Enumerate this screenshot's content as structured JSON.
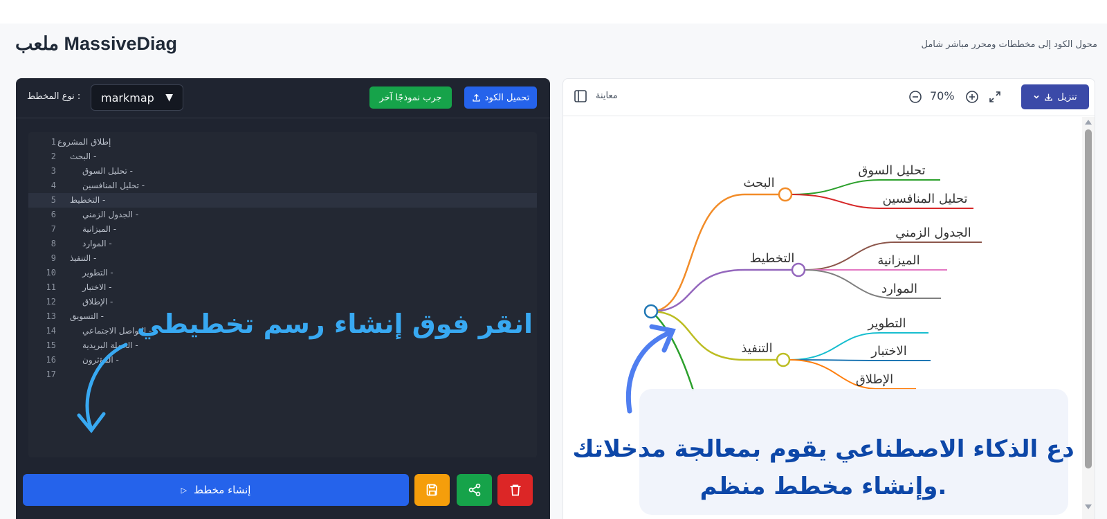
{
  "header": {
    "title": "MassiveDiag ملعب",
    "subtitle": "محول الكود إلى مخططات ومحرر مباشر شامل"
  },
  "editor": {
    "diagram_type_label": ": نوع المخطط",
    "diagram_type_value": "markmap",
    "try_sample_label": "جرب نموذجًا آخر",
    "load_code_label": "تحميل الكود",
    "code_lines": [
      {
        "n": "1",
        "text": "إطلاق المشروع"
      },
      {
        "n": "2",
        "text": "- البحث"
      },
      {
        "n": "3",
        "text": "- تحليل السوق"
      },
      {
        "n": "4",
        "text": "- تحليل المنافسين"
      },
      {
        "n": "5",
        "text": "- التخطيط"
      },
      {
        "n": "6",
        "text": "- الجدول الزمني"
      },
      {
        "n": "7",
        "text": "- الميزانية"
      },
      {
        "n": "8",
        "text": "- الموارد"
      },
      {
        "n": "9",
        "text": "- التنفيذ"
      },
      {
        "n": "10",
        "text": "- التطوير"
      },
      {
        "n": "11",
        "text": "- الاختبار"
      },
      {
        "n": "12",
        "text": "- الإطلاق"
      },
      {
        "n": "13",
        "text": "- التسويق"
      },
      {
        "n": "14",
        "text": "- التواصل الاجتماعي"
      },
      {
        "n": "15",
        "text": "- الحملة البريدية"
      },
      {
        "n": "16",
        "text": "- المؤثرون"
      },
      {
        "n": "17",
        "text": ""
      }
    ],
    "generate_label": "إنشاء مخطط"
  },
  "preview": {
    "label": "معاينة",
    "zoom": "70%",
    "download_label": "تنزيل",
    "mindmap": {
      "branches": [
        {
          "label": "البحث",
          "color": "#f28c28",
          "children": [
            {
              "label": "تحليل السوق",
              "color": "#2ca02c"
            },
            {
              "label": "تحليل المنافسين",
              "color": "#d62728"
            }
          ]
        },
        {
          "label": "التخطيط",
          "color": "#9467bd",
          "children": [
            {
              "label": "الجدول الزمني",
              "color": "#8c564b"
            },
            {
              "label": "الميزانية",
              "color": "#e377c2"
            },
            {
              "label": "الموارد",
              "color": "#7f7f7f"
            }
          ]
        },
        {
          "label": "التنفيذ",
          "color": "#bcbd22",
          "children": [
            {
              "label": "التطوير",
              "color": "#17becf"
            },
            {
              "label": "الاختبار",
              "color": "#1f77b4"
            },
            {
              "label": "الإطلاق",
              "color": "#ff7f0e"
            }
          ]
        }
      ],
      "root_color": "#1f77b4",
      "partial_branch_color": "#2ca02c"
    }
  },
  "overlays": {
    "editor_hint": "انقر فوق إنشاء رسم تخطيطي",
    "preview_hint_line1": "دع الذكاء الاصطناعي يقوم بمعالجة مدخلاتك",
    "preview_hint_line2": ".وإنشاء مخطط منظم"
  },
  "colors": {
    "editor_hint": "#38a9f2",
    "preview_hint": "#0d47a8"
  }
}
